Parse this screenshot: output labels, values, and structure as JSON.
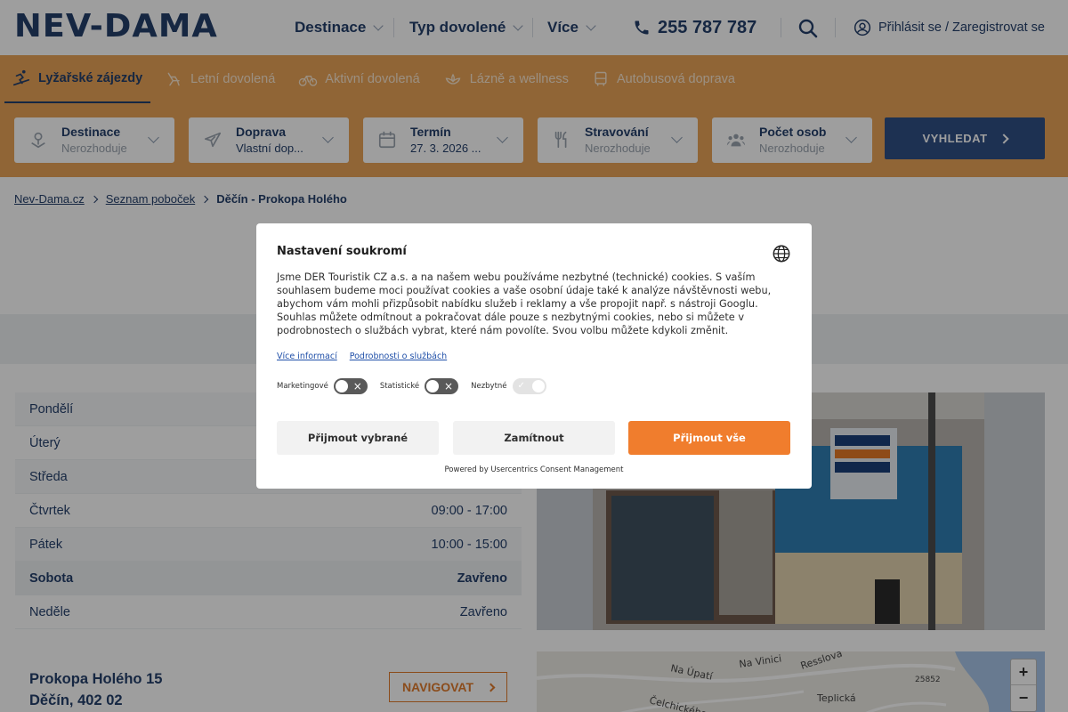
{
  "header": {
    "logo": "NEV-DAMA",
    "nav": [
      "Destinace",
      "Typ dovolené",
      "Více"
    ],
    "phone": "255 787 787",
    "login": "Přihlásit se / Zaregistrovat se"
  },
  "tabs": [
    {
      "label": "Lyžařské zájezdy",
      "icon": "ski-icon"
    },
    {
      "label": "Letní dovolená",
      "icon": "beach-chair-icon"
    },
    {
      "label": "Aktivní dovolená",
      "icon": "bicycle-icon"
    },
    {
      "label": "Lázně a wellness",
      "icon": "spa-icon"
    },
    {
      "label": "Autobusová doprava",
      "icon": "bus-icon"
    }
  ],
  "filters": [
    {
      "label": "Destinace",
      "value": "Nerozhoduje"
    },
    {
      "label": "Doprava",
      "value": "Vlastní dop..."
    },
    {
      "label": "Termín",
      "value": "27. 3. 2026 ..."
    },
    {
      "label": "Stravování",
      "value": "Nerozhoduje"
    },
    {
      "label": "Počet osob",
      "value": "Nerozhoduje"
    }
  ],
  "search_label": "VYHLEDAT",
  "breadcrumb": [
    "Nev-Dama.cz",
    "Seznam poboček",
    "Děčín - Prokopa Holého"
  ],
  "hours": [
    {
      "day": "Pondělí",
      "time": ""
    },
    {
      "day": "Úterý",
      "time": ""
    },
    {
      "day": "Středa",
      "time": ""
    },
    {
      "day": "Čtvrtek",
      "time": "09:00 - 17:00"
    },
    {
      "day": "Pátek",
      "time": "10:00 - 15:00"
    },
    {
      "day": "Sobota",
      "time": "Zavřeno"
    },
    {
      "day": "Neděle",
      "time": "Zavřeno"
    }
  ],
  "address": {
    "street": "Prokopa Holého 15",
    "city": "Děčín, 402 02",
    "navigate": "NAVIGOVAT"
  },
  "map": {
    "labels": [
      "Na Úpatí",
      "Na Vinici",
      "Resslova",
      "Teplická",
      "Čelchického",
      "25852"
    ]
  },
  "consent": {
    "title": "Nastavení soukromí",
    "body": "Jsme DER Touristik CZ a.s. a na našem webu používáme nezbytné (technické) cookies. S vaším souhlasem budeme moci používat cookies a vaše osobní údaje také k analýze návštěvnosti webu, abychom vám mohli přizpůsobit nabídku služeb i reklamy a vše propojit např. s nástroji Googlu. Souhlas můžete odmítnout a pokračovat dále pouze s nezbytnými cookies, nebo si můžete v podrobnostech o službách vybrat, které nám povolíte. Svou volbu můžete kdykoli změnit.",
    "link_more": "Více informací",
    "link_details": "Podrobnosti o službách",
    "toggles": [
      "Marketingové",
      "Statistické",
      "Nezbytné"
    ],
    "btn_selected": "Přijmout vybrané",
    "btn_reject": "Zamítnout",
    "btn_all": "Přijmout vše",
    "powered": "Powered by Usercentrics Consent Management"
  },
  "colors": {
    "brand_navy": "#243f6b",
    "band_orange": "#e9a357",
    "accept_orange": "#f07d2d"
  }
}
